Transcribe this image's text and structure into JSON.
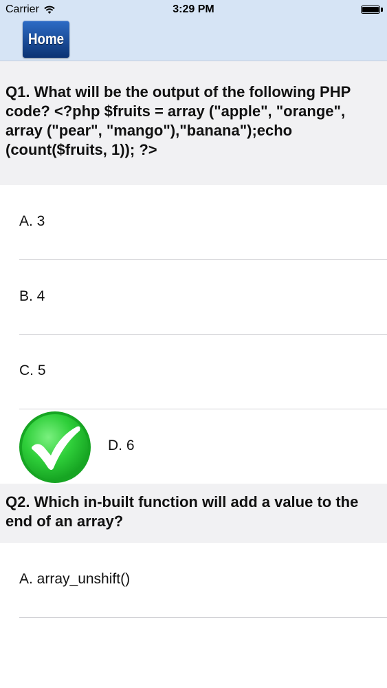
{
  "status_bar": {
    "carrier": "Carrier",
    "time": "3:29 PM"
  },
  "nav": {
    "home_label": "Home"
  },
  "questions": [
    {
      "text": "Q1. What will be the output of the following PHP code? <?php $fruits = array (\"apple\", \"orange\", array (\"pear\", \"mango\"),\"banana\");echo (count($fruits, 1)); ?>",
      "options": [
        {
          "label": "A. 3"
        },
        {
          "label": "B. 4"
        },
        {
          "label": "C. 5"
        },
        {
          "label": "D. 6",
          "status": "correct"
        }
      ]
    },
    {
      "text": "Q2. Which in-built function will add a value to the end of an array?",
      "options": [
        {
          "label": "A.  array_unshift()"
        }
      ]
    }
  ],
  "icons": {
    "correct": "check-icon",
    "wifi": "wifi-icon",
    "battery": "battery-icon"
  },
  "colors": {
    "nav_background": "#d6e4f5",
    "home_button": "#1c4f9c",
    "question_background": "#f1f1f3",
    "check_green": "#2fcf3a"
  }
}
